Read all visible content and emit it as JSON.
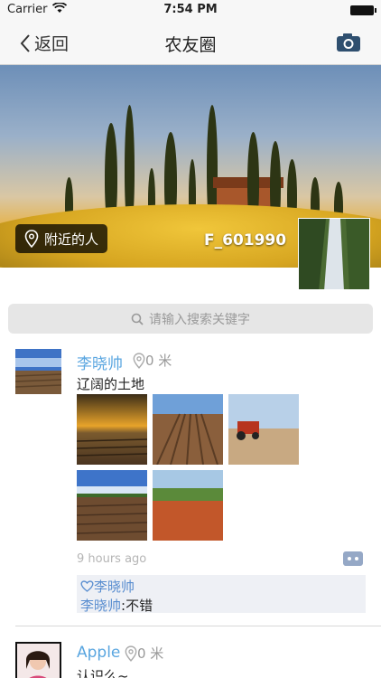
{
  "status": {
    "carrier": "Carrier",
    "time": "7:54 PM"
  },
  "nav": {
    "back_label": "返回",
    "title": "农友圈"
  },
  "banner": {
    "nearby_label": "附近的人",
    "username": "F_601990"
  },
  "search": {
    "placeholder": "请输入搜索关键字"
  },
  "posts": [
    {
      "name": "李晓帅",
      "distance": "0 米",
      "text": "辽阔的土地",
      "time": "9 hours ago",
      "likes": "李晓帅",
      "comment": {
        "author": "李晓帅",
        "text": ":不错"
      }
    },
    {
      "name": "Apple",
      "distance": "0 米",
      "text": "认识么~"
    }
  ],
  "colors": {
    "link_blue": "#5aa6e0",
    "nav_bg": "#f7f7f7",
    "search_bg": "#e6e6e6"
  }
}
